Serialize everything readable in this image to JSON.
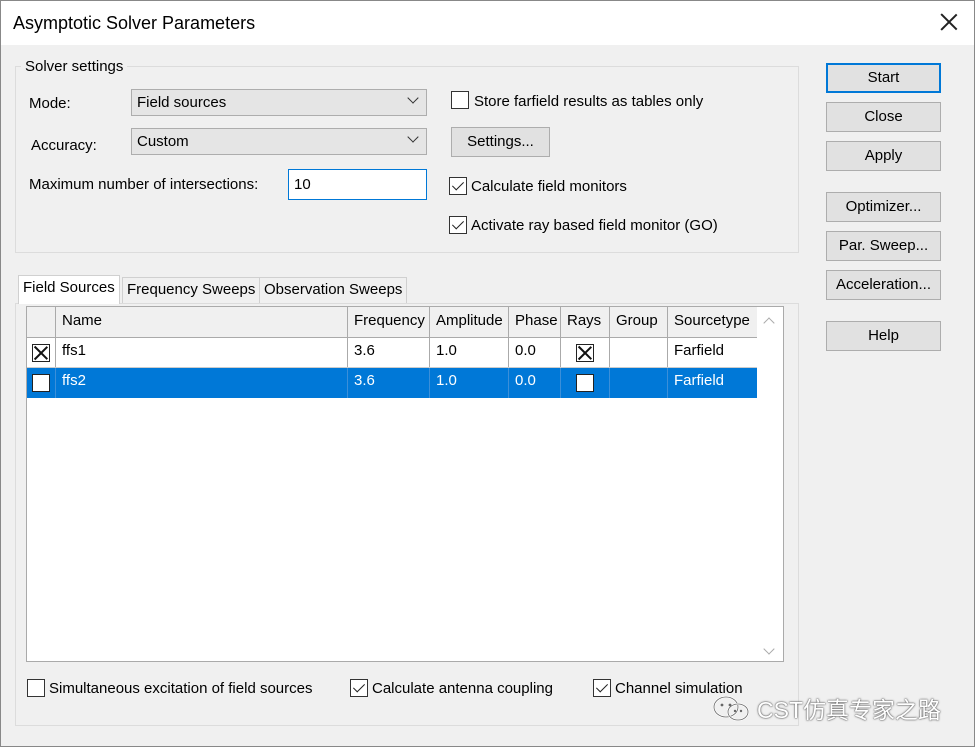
{
  "window": {
    "title": "Asymptotic Solver Parameters"
  },
  "solver_settings": {
    "legend": "Solver settings",
    "mode_label": "Mode:",
    "mode_value": "Field sources",
    "accuracy_label": "Accuracy:",
    "accuracy_value": "Custom",
    "max_intersections_label": "Maximum number of intersections:",
    "max_intersections_value": "10",
    "store_farfield_label": "Store farfield results as tables only",
    "store_farfield_checked": false,
    "settings_button": "Settings...",
    "calc_field_monitors_label": "Calculate field monitors",
    "calc_field_monitors_checked": true,
    "activate_ray_label": "Activate ray based field monitor (GO)",
    "activate_ray_checked": true
  },
  "buttons": {
    "start": "Start",
    "close": "Close",
    "apply": "Apply",
    "optimizer": "Optimizer...",
    "par_sweep": "Par. Sweep...",
    "acceleration": "Acceleration...",
    "help": "Help"
  },
  "tabs": [
    {
      "label": "Field Sources",
      "active": true
    },
    {
      "label": "Frequency Sweeps",
      "active": false
    },
    {
      "label": "Observation Sweeps",
      "active": false
    }
  ],
  "table": {
    "columns": [
      "Name",
      "Frequency",
      "Amplitude",
      "Phase",
      "Rays",
      "Group",
      "Sourcetype"
    ],
    "rows": [
      {
        "enabled": true,
        "name": "ffs1",
        "frequency": "3.6",
        "amplitude": "1.0",
        "phase": "0.0",
        "rays": true,
        "group": "",
        "sourcetype": "Farfield",
        "selected": false
      },
      {
        "enabled": false,
        "name": "ffs2",
        "frequency": "3.6",
        "amplitude": "1.0",
        "phase": "0.0",
        "rays": false,
        "group": "",
        "sourcetype": "Farfield",
        "selected": true
      }
    ]
  },
  "bottom_options": {
    "simultaneous_label": "Simultaneous excitation of field sources",
    "simultaneous_checked": false,
    "antenna_coupling_label": "Calculate antenna coupling",
    "antenna_coupling_checked": true,
    "channel_sim_label": "Channel simulation",
    "channel_sim_checked": true
  },
  "watermark": {
    "text": "CST仿真专家之路",
    "icon": "wechat-icon"
  },
  "colors": {
    "accent": "#0078d7",
    "selected_row": "#0078d7"
  }
}
